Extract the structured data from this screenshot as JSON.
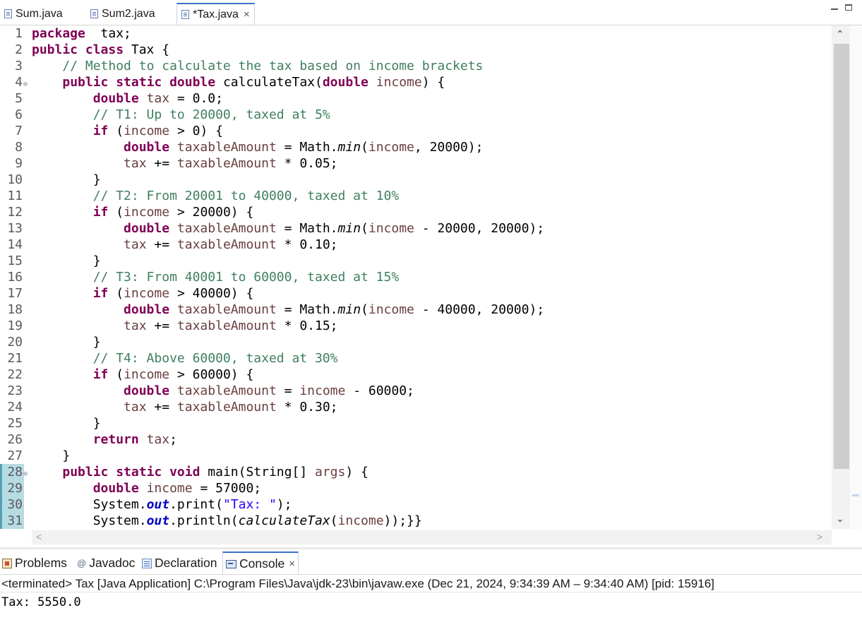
{
  "editor_tabs": [
    {
      "label": "Sum.java"
    },
    {
      "label": "Sum2.java"
    },
    {
      "label": "*Tax.java",
      "close": "×"
    }
  ],
  "code_lines": [
    {
      "n": "1",
      "segs": [
        [
          "kw",
          "package"
        ],
        [
          "",
          "  tax;"
        ]
      ]
    },
    {
      "n": "2",
      "segs": [
        [
          "kw",
          "public class"
        ],
        [
          "",
          " Tax {"
        ]
      ]
    },
    {
      "n": "3",
      "segs": [
        [
          "",
          "    "
        ],
        [
          "cm",
          "// Method to calculate the tax based on income brackets"
        ]
      ]
    },
    {
      "n": "4",
      "fold": true,
      "segs": [
        [
          "",
          "    "
        ],
        [
          "kw",
          "public static double"
        ],
        [
          "",
          " calculateTax("
        ],
        [
          "kw",
          "double"
        ],
        [
          "",
          " "
        ],
        [
          "var",
          "income"
        ],
        [
          "",
          ") {"
        ]
      ]
    },
    {
      "n": "5",
      "segs": [
        [
          "",
          "        "
        ],
        [
          "kw",
          "double"
        ],
        [
          "",
          " "
        ],
        [
          "var",
          "tax"
        ],
        [
          "",
          " = 0.0;"
        ]
      ]
    },
    {
      "n": "6",
      "segs": [
        [
          "",
          "        "
        ],
        [
          "cm",
          "// T1: Up to 20000, taxed at 5%"
        ]
      ]
    },
    {
      "n": "7",
      "segs": [
        [
          "",
          "        "
        ],
        [
          "kw",
          "if"
        ],
        [
          "",
          " ("
        ],
        [
          "var",
          "income"
        ],
        [
          "",
          " > 0) {"
        ]
      ]
    },
    {
      "n": "8",
      "segs": [
        [
          "",
          "            "
        ],
        [
          "kw",
          "double"
        ],
        [
          "",
          " "
        ],
        [
          "var",
          "taxableAmount"
        ],
        [
          "",
          " = Math."
        ],
        [
          "it",
          "min"
        ],
        [
          "",
          "("
        ],
        [
          "var",
          "income"
        ],
        [
          "",
          ", 20000);"
        ]
      ]
    },
    {
      "n": "9",
      "segs": [
        [
          "",
          "            "
        ],
        [
          "var",
          "tax"
        ],
        [
          "",
          " += "
        ],
        [
          "var",
          "taxableAmount"
        ],
        [
          "",
          " * 0.05;"
        ]
      ]
    },
    {
      "n": "10",
      "segs": [
        [
          "",
          "        }"
        ]
      ]
    },
    {
      "n": "11",
      "segs": [
        [
          "",
          "        "
        ],
        [
          "cm",
          "// T2: From 20001 to 40000, taxed at 10%"
        ]
      ]
    },
    {
      "n": "12",
      "segs": [
        [
          "",
          "        "
        ],
        [
          "kw",
          "if"
        ],
        [
          "",
          " ("
        ],
        [
          "var",
          "income"
        ],
        [
          "",
          " > 20000) {"
        ]
      ]
    },
    {
      "n": "13",
      "segs": [
        [
          "",
          "            "
        ],
        [
          "kw",
          "double"
        ],
        [
          "",
          " "
        ],
        [
          "var",
          "taxableAmount"
        ],
        [
          "",
          " = Math."
        ],
        [
          "it",
          "min"
        ],
        [
          "",
          "("
        ],
        [
          "var",
          "income"
        ],
        [
          "",
          " - 20000, 20000);"
        ]
      ]
    },
    {
      "n": "14",
      "segs": [
        [
          "",
          "            "
        ],
        [
          "var",
          "tax"
        ],
        [
          "",
          " += "
        ],
        [
          "var",
          "taxableAmount"
        ],
        [
          "",
          " * 0.10;"
        ]
      ]
    },
    {
      "n": "15",
      "segs": [
        [
          "",
          "        }"
        ]
      ]
    },
    {
      "n": "16",
      "segs": [
        [
          "",
          "        "
        ],
        [
          "cm",
          "// T3: From 40001 to 60000, taxed at 15%"
        ]
      ]
    },
    {
      "n": "17",
      "segs": [
        [
          "",
          "        "
        ],
        [
          "kw",
          "if"
        ],
        [
          "",
          " ("
        ],
        [
          "var",
          "income"
        ],
        [
          "",
          " > 40000) {"
        ]
      ]
    },
    {
      "n": "18",
      "segs": [
        [
          "",
          "            "
        ],
        [
          "kw",
          "double"
        ],
        [
          "",
          " "
        ],
        [
          "var",
          "taxableAmount"
        ],
        [
          "",
          " = Math."
        ],
        [
          "it",
          "min"
        ],
        [
          "",
          "("
        ],
        [
          "var",
          "income"
        ],
        [
          "",
          " - 40000, 20000);"
        ]
      ]
    },
    {
      "n": "19",
      "segs": [
        [
          "",
          "            "
        ],
        [
          "var",
          "tax"
        ],
        [
          "",
          " += "
        ],
        [
          "var",
          "taxableAmount"
        ],
        [
          "",
          " * 0.15;"
        ]
      ]
    },
    {
      "n": "20",
      "segs": [
        [
          "",
          "        }"
        ]
      ]
    },
    {
      "n": "21",
      "segs": [
        [
          "",
          "        "
        ],
        [
          "cm",
          "// T4: Above 60000, taxed at 30%"
        ]
      ]
    },
    {
      "n": "22",
      "segs": [
        [
          "",
          "        "
        ],
        [
          "kw",
          "if"
        ],
        [
          "",
          " ("
        ],
        [
          "var",
          "income"
        ],
        [
          "",
          " > 60000) {"
        ]
      ]
    },
    {
      "n": "23",
      "segs": [
        [
          "",
          "            "
        ],
        [
          "kw",
          "double"
        ],
        [
          "",
          " "
        ],
        [
          "var",
          "taxableAmount"
        ],
        [
          "",
          " = "
        ],
        [
          "var",
          "income"
        ],
        [
          "",
          " - 60000;"
        ]
      ]
    },
    {
      "n": "24",
      "segs": [
        [
          "",
          "            "
        ],
        [
          "var",
          "tax"
        ],
        [
          "",
          " += "
        ],
        [
          "var",
          "taxableAmount"
        ],
        [
          "",
          " * 0.30;"
        ]
      ]
    },
    {
      "n": "25",
      "segs": [
        [
          "",
          "        }"
        ]
      ]
    },
    {
      "n": "26",
      "segs": [
        [
          "",
          "        "
        ],
        [
          "kw",
          "return"
        ],
        [
          "",
          " "
        ],
        [
          "var",
          "tax"
        ],
        [
          "",
          ";"
        ]
      ]
    },
    {
      "n": "27",
      "segs": [
        [
          "",
          "    }"
        ]
      ]
    },
    {
      "n": "28",
      "fold": true,
      "changed": true,
      "segs": [
        [
          "",
          "    "
        ],
        [
          "kw",
          "public static void"
        ],
        [
          "",
          " main(String[] "
        ],
        [
          "var",
          "args"
        ],
        [
          "",
          ") {"
        ]
      ]
    },
    {
      "n": "29",
      "changed": true,
      "segs": [
        [
          "",
          "        "
        ],
        [
          "kw",
          "double"
        ],
        [
          "",
          " "
        ],
        [
          "var",
          "income"
        ],
        [
          "",
          " = 57000;"
        ]
      ]
    },
    {
      "n": "30",
      "changed": true,
      "segs": [
        [
          "",
          "        System."
        ],
        [
          "fld",
          "out"
        ],
        [
          "",
          ".print("
        ],
        [
          "st",
          "\"Tax: \""
        ],
        [
          "",
          ");"
        ]
      ]
    },
    {
      "n": "31",
      "changed": true,
      "segs": [
        [
          "",
          "        System."
        ],
        [
          "fld",
          "out"
        ],
        [
          "",
          ".println("
        ],
        [
          "it",
          "calculateTax"
        ],
        [
          "",
          "("
        ],
        [
          "var",
          "income"
        ],
        [
          "",
          "));}}"
        ]
      ]
    }
  ],
  "view_tabs": [
    {
      "label": "Problems",
      "icon": "problems-icon"
    },
    {
      "label": "Javadoc",
      "icon": "at-sign-icon"
    },
    {
      "label": "Declaration",
      "icon": "declaration-icon"
    },
    {
      "label": "Console",
      "icon": "console-icon",
      "close": "×"
    }
  ],
  "console": {
    "status": "<terminated> Tax [Java Application] C:\\Program Files\\Java\\jdk-23\\bin\\javaw.exe  (Dec 21, 2024, 9:34:39 AM – 9:34:40 AM) [pid: 15916]",
    "output": "Tax: 5550.0"
  },
  "colors": {
    "keyword": "#7f0055",
    "comment": "#3f7f5f",
    "local_variable": "#6a3e3e",
    "string": "#2a00ff",
    "field": "#0000c0",
    "active_tab_accent": "#3a73c8"
  }
}
